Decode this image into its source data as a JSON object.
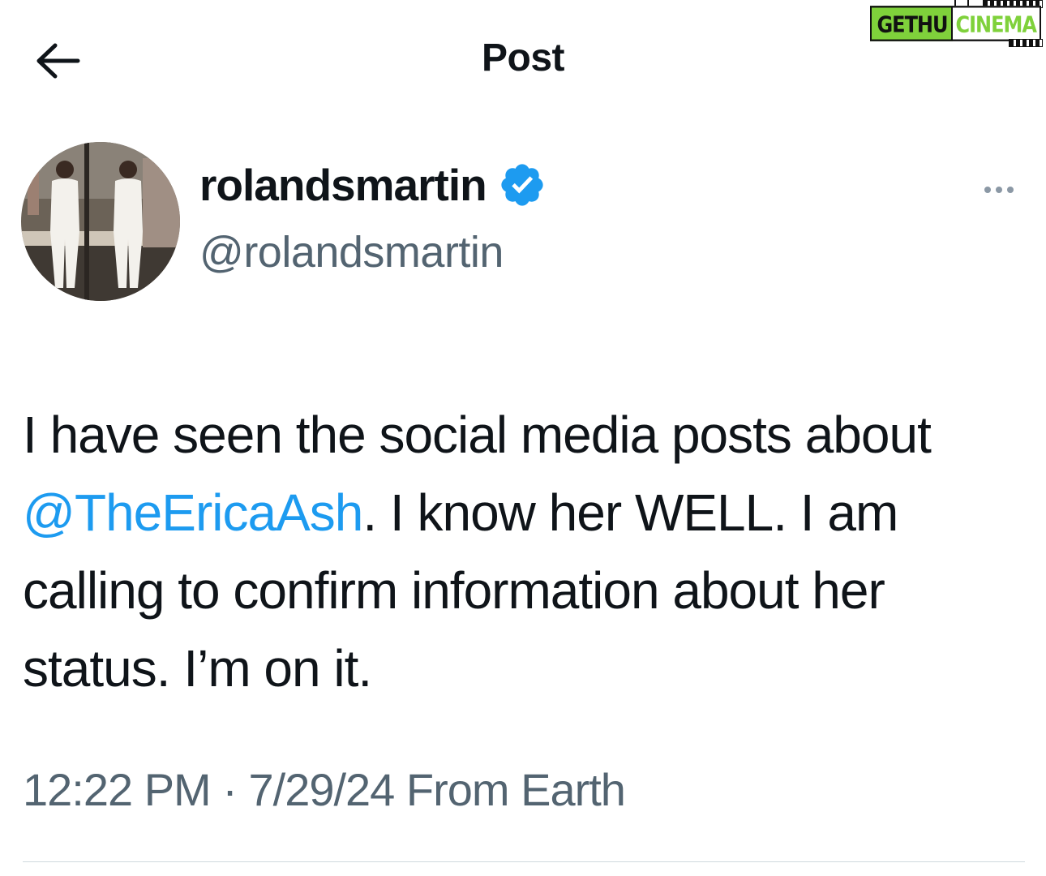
{
  "watermark": {
    "part1": "GETHU",
    "part2": "CINEMA"
  },
  "header": {
    "back_icon": "arrow-left-icon",
    "title": "Post"
  },
  "author": {
    "display_name": "rolandsmartin",
    "handle": "@rolandsmartin",
    "verified_icon": "verified-badge-icon",
    "more_icon": "more-horizontal-icon"
  },
  "tweet": {
    "text_before_mention": "I have seen the social media posts about ",
    "mention": "@TheEricaAsh",
    "text_after_mention": ". I know her WELL. I am calling to confirm information about her status. I’m on it."
  },
  "meta": {
    "time": "12:22 PM",
    "separator": "·",
    "date": "7/29/24",
    "source": "From Earth"
  },
  "colors": {
    "text": "#0f1419",
    "secondary": "#536471",
    "link": "#1d9bf0",
    "verified": "#1d9bf0",
    "watermark_green": "#7fd13b"
  }
}
